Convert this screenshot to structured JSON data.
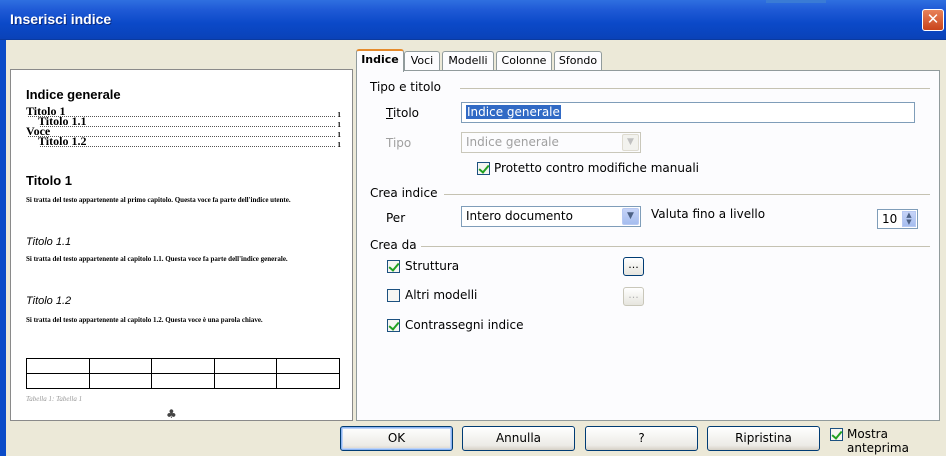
{
  "window": {
    "title": "Inserisci indice",
    "close_glyph": "✕"
  },
  "tabs": [
    {
      "label": "Indice",
      "active": true
    },
    {
      "label": "Voci"
    },
    {
      "label": "Modelli"
    },
    {
      "label": "Colonne"
    },
    {
      "label": "Sfondo"
    }
  ],
  "preview": {
    "toc_title": "Indice generale",
    "toc_entries": [
      {
        "label": "Titolo 1",
        "page": "1"
      },
      {
        "label": "Titolo 1.1",
        "page": "1"
      },
      {
        "label": "Voce",
        "page": "1"
      },
      {
        "label": "Titolo 1.2",
        "page": "1"
      }
    ],
    "heading1": "Titolo 1",
    "heading1_text": "Si tratta del testo appartenente al primo capitolo. Questa voce fa parte dell'indice utente.",
    "heading11": "Titolo 1.1",
    "heading11_text": "Si tratta del testo appartenente al capitolo 1.1. Questa voce fa parte dell'indice generale.",
    "heading12": "Titolo 1.2",
    "heading12_text": "Si tratta del testo appartenente al capitolo 1.2. Questa voce è una parola chiave.",
    "table_caption": "Tabella 1: Tabella 1",
    "cursor_glyph": "♣"
  },
  "type_title": {
    "section": "Tipo e titolo",
    "title_label": "Titolo",
    "title_value": "Indice generale",
    "type_label": "Tipo",
    "type_value": "Indice generale",
    "protected_label": "Protetto contro modifiche manuali",
    "protected_checked": true
  },
  "create_index": {
    "section": "Crea indice",
    "for_label": "Per",
    "for_value": "Intero documento",
    "eval_label": "Valuta fino a livello",
    "level_value": "10"
  },
  "create_from": {
    "section": "Crea da",
    "structure_label": "Struttura",
    "structure_checked": true,
    "other_styles_label": "Altri modelli",
    "other_styles_checked": false,
    "index_marks_label": "Contrassegni indice",
    "index_marks_checked": true,
    "browse_label": "..."
  },
  "buttons": {
    "ok": "OK",
    "cancel": "Annulla",
    "help": "?",
    "reset": "Ripristina",
    "show_preview": "Mostra anteprima",
    "show_preview_checked": true
  },
  "glyphs": {
    "dropdown_arrow": "▼",
    "spin_up": "▲",
    "spin_down": "▼"
  }
}
